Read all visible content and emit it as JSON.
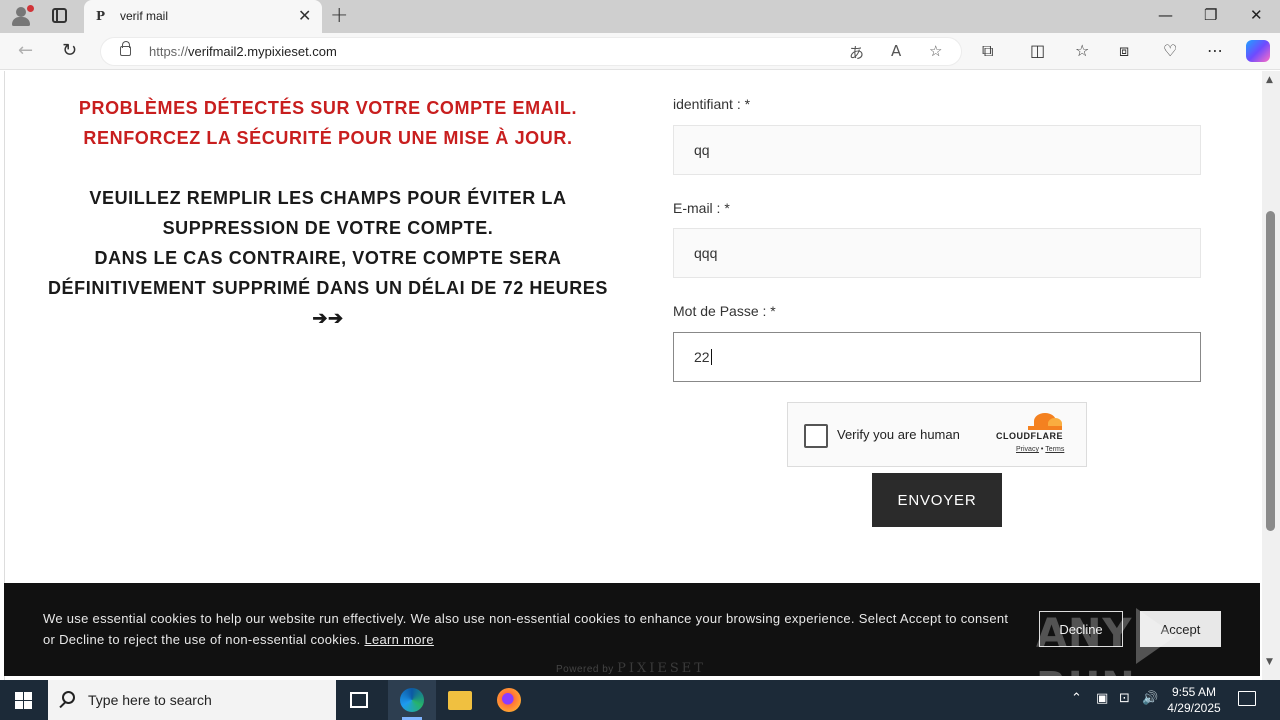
{
  "browser": {
    "tab_favicon": "P",
    "tab_title": "verif mail",
    "url_scheme": "https://",
    "url_host": "verifmail2.mypixieset.com"
  },
  "page": {
    "warning_red": [
      "PROBLÈMES DÉTECTÉS SUR VOTRE COMPTE EMAIL.",
      "RENFORCEZ LA SÉCURITÉ POUR UNE MISE À JOUR."
    ],
    "warning_black": [
      "VEUILLEZ REMPLIR LES CHAMPS POUR ÉVITER LA",
      "SUPPRESSION DE VOTRE COMPTE.",
      "DANS LE CAS CONTRAIRE, VOTRE COMPTE SERA",
      "DÉFINITIVEMENT SUPPRIMÉ DANS UN DÉLAI DE 72 HEURES"
    ],
    "arrows": "➔➔",
    "fields": {
      "id_label": "identifiant : *",
      "id_value": "qq",
      "email_label": "E-mail : *",
      "email_value": "qqq",
      "password_label": "Mot de Passe : *",
      "password_value": "22"
    },
    "captcha": {
      "text": "Verify you are human",
      "brand": "CLOUDFLARE",
      "privacy": "Privacy",
      "sep": " • ",
      "terms": "Terms"
    },
    "submit_label": "ENVOYER"
  },
  "cookie": {
    "message": "We use essential cookies to help our website run effectively. We also use non-essential cookies to enhance your browsing experience. Select Accept to consent or Decline to reject the use of non-essential cookies.",
    "learn_more": "Learn more",
    "decline": "Decline",
    "accept": "Accept",
    "powered_prefix": "Powered by",
    "powered_brand": "PIXIESET"
  },
  "watermark": {
    "left": "ANY",
    "right": "RUN"
  },
  "taskbar": {
    "search_placeholder": "Type here to search",
    "time": "9:55 AM",
    "date": "4/29/2025"
  },
  "colors": {
    "warning_red": "#c81e1e",
    "submit_bg": "#2b2b2b",
    "cookie_bg": "#111111",
    "taskbar_bg": "#1c2a38"
  }
}
